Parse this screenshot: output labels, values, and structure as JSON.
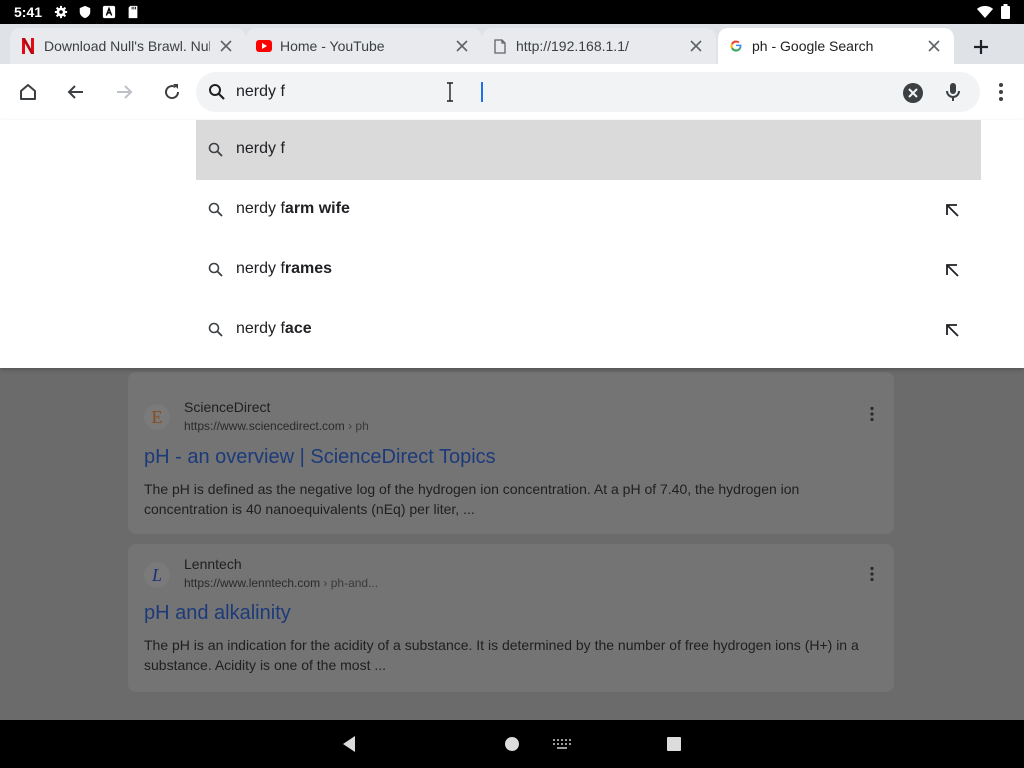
{
  "status_bar": {
    "time": "5:41",
    "left_icons": [
      "gear-icon",
      "shield-icon",
      "font-a-icon",
      "sd-card-icon"
    ],
    "right_icons": [
      "wifi-icon",
      "battery-icon"
    ]
  },
  "tabs": [
    {
      "title": "Download Null's Brawl. Null's",
      "favicon": "netflix-n-icon",
      "active": false
    },
    {
      "title": "Home - YouTube",
      "favicon": "youtube-icon",
      "active": false
    },
    {
      "title": "http://192.168.1.1/",
      "favicon": "page-icon",
      "active": false
    },
    {
      "title": "ph - Google Search",
      "favicon": "google-g-icon",
      "active": true
    }
  ],
  "omnibox": {
    "value": "nerdy f"
  },
  "suggestions": [
    {
      "prefix": "nerdy f",
      "bold": "",
      "highlight": true,
      "has_arrow": false
    },
    {
      "prefix": "nerdy f",
      "bold": "arm wife",
      "highlight": false,
      "has_arrow": true
    },
    {
      "prefix": "nerdy f",
      "bold": "rames",
      "highlight": false,
      "has_arrow": true
    },
    {
      "prefix": "nerdy f",
      "bold": "ace",
      "highlight": false,
      "has_arrow": true
    }
  ],
  "results": [
    {
      "site_name": "ScienceDirect",
      "url": "https://www.sciencedirect.com",
      "crumb": " › ph",
      "icon_letter": "E",
      "title": "pH - an overview | ScienceDirect Topics",
      "snippet": "The pH is defined as the negative log of the hydrogen ion concentration. At a pH of 7.40, the hydrogen ion concentration is 40 nanoequivalents (nEq) per liter, ..."
    },
    {
      "site_name": "Lenntech",
      "url": "https://www.lenntech.com",
      "crumb": " › ph-and...",
      "icon_letter": "L",
      "title": "pH and alkalinity",
      "snippet": "The pH is an indication for the acidity of a substance. It is determined by the number of free hydrogen ions (H+) in a substance. Acidity is one of the most ..."
    }
  ],
  "colors": {
    "accent": "#1a73e8",
    "scrim": "#6b6b6b",
    "highlight": "#dadada"
  }
}
